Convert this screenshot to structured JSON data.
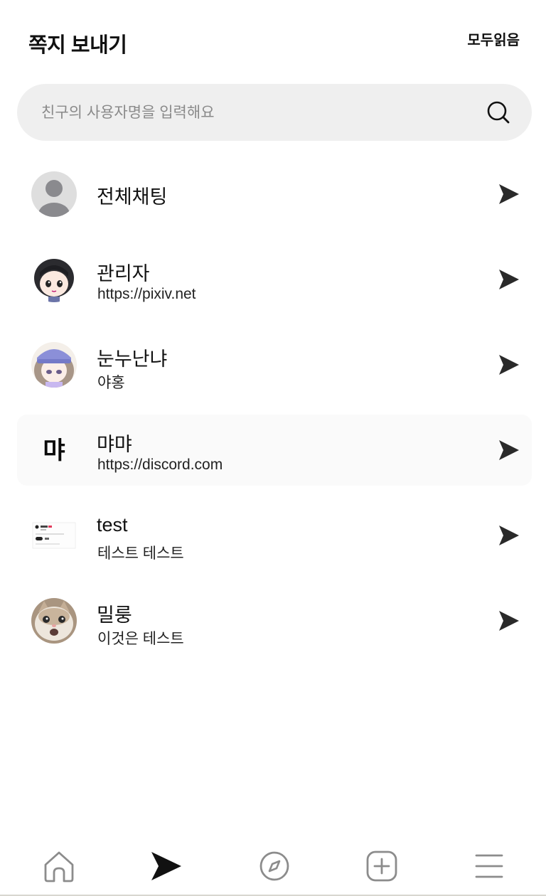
{
  "header": {
    "title": "쪽지 보내기",
    "read_all": "모두읽음"
  },
  "search": {
    "placeholder": "친구의 사용자명을 입력해요",
    "icon": "search-icon"
  },
  "chats": [
    {
      "name": "전체채팅",
      "subtitle": "",
      "avatar": "default-user-avatar"
    },
    {
      "name": "관리자",
      "subtitle": "https://pixiv.net",
      "avatar": "anime-boy-avatar"
    },
    {
      "name": "눈누난냐",
      "subtitle": "야홍",
      "avatar": "anime-girl-avatar"
    },
    {
      "name": "먀먀",
      "subtitle": "https://discord.com",
      "avatar": "text-logo-avatar",
      "avatar_text": "먀"
    },
    {
      "name": "test",
      "subtitle": "테스트 테스트",
      "avatar": "screenshot-thumbnail-avatar"
    },
    {
      "name": "밀룽",
      "subtitle": "이것은 테스트",
      "avatar": "cat-photo-avatar"
    }
  ],
  "nav": [
    {
      "id": "home",
      "icon": "home-icon",
      "active": false
    },
    {
      "id": "messages",
      "icon": "send-icon",
      "active": true
    },
    {
      "id": "explore",
      "icon": "compass-icon",
      "active": false
    },
    {
      "id": "create",
      "icon": "plus-square-icon",
      "active": false
    },
    {
      "id": "menu",
      "icon": "menu-icon",
      "active": false
    }
  ],
  "colors": {
    "accent": "#111111",
    "inactive_icon": "#8c8c8c",
    "search_bg": "#efefef"
  }
}
